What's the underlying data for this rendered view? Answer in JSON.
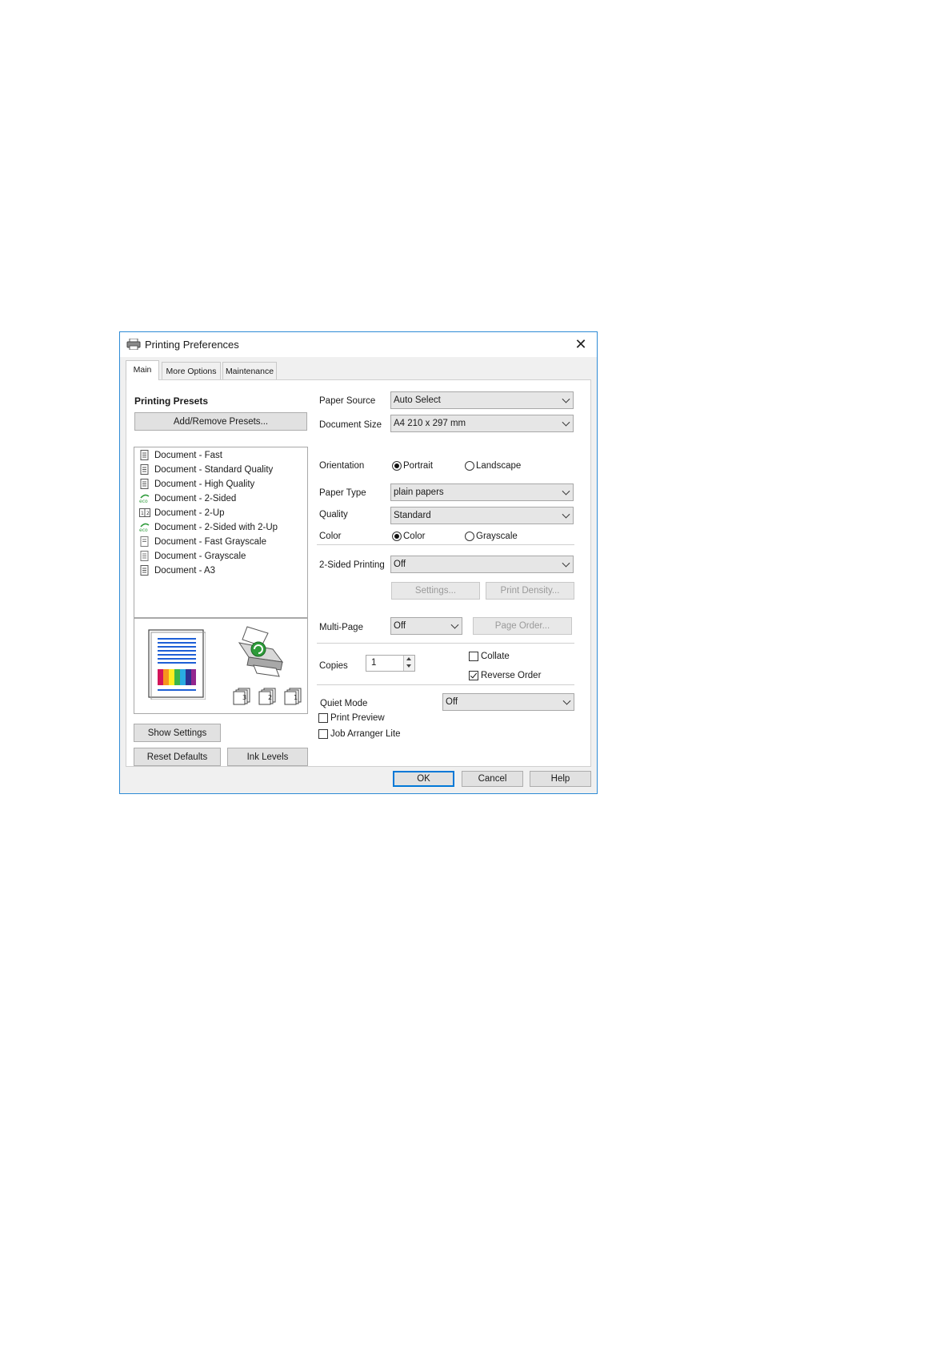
{
  "window": {
    "title": "Printing Preferences"
  },
  "tabs": [
    {
      "label": "Main"
    },
    {
      "label": "More Options"
    },
    {
      "label": "Maintenance"
    }
  ],
  "presets": {
    "heading": "Printing Presets",
    "add_remove_label": "Add/Remove Presets...",
    "items": [
      {
        "label": "Document - Fast",
        "icon": "document-icon"
      },
      {
        "label": "Document - Standard Quality",
        "icon": "document-icon"
      },
      {
        "label": "Document - High Quality",
        "icon": "document-icon"
      },
      {
        "label": "Document - 2-Sided",
        "icon": "eco-icon"
      },
      {
        "label": "Document - 2-Up",
        "icon": "two-up-icon"
      },
      {
        "label": "Document - 2-Sided with 2-Up",
        "icon": "eco-icon"
      },
      {
        "label": "Document - Fast Grayscale",
        "icon": "document-icon"
      },
      {
        "label": "Document - Grayscale",
        "icon": "document-icon"
      },
      {
        "label": "Document - A3",
        "icon": "document-icon"
      }
    ],
    "preview_copy_numbers": [
      "3",
      "2",
      "1"
    ]
  },
  "buttons": {
    "show_settings": "Show Settings",
    "reset_defaults": "Reset Defaults",
    "ink_levels": "Ink Levels",
    "settings": "Settings...",
    "print_density": "Print Density...",
    "page_order": "Page Order...",
    "ok": "OK",
    "cancel": "Cancel",
    "help": "Help"
  },
  "settings": {
    "paper_source": {
      "label": "Paper Source",
      "value": "Auto Select"
    },
    "document_size": {
      "label": "Document Size",
      "value": "A4 210 x 297 mm"
    },
    "orientation": {
      "label": "Orientation",
      "options": [
        "Portrait",
        "Landscape"
      ],
      "selected": "Portrait"
    },
    "paper_type": {
      "label": "Paper Type",
      "value": "plain papers"
    },
    "quality": {
      "label": "Quality",
      "value": "Standard"
    },
    "color": {
      "label": "Color",
      "options": [
        "Color",
        "Grayscale"
      ],
      "selected": "Color"
    },
    "two_sided": {
      "label": "2-Sided Printing",
      "value": "Off"
    },
    "multi_page": {
      "label": "Multi-Page",
      "value": "Off"
    },
    "copies": {
      "label": "Copies",
      "value": "1"
    },
    "collate": {
      "label": "Collate",
      "checked": false
    },
    "reverse_order": {
      "label": "Reverse Order",
      "checked": true
    },
    "quiet_mode": {
      "label": "Quiet Mode",
      "value": "Off"
    },
    "print_preview": {
      "label": "Print Preview",
      "checked": false
    },
    "job_arranger": {
      "label": "Job Arranger Lite",
      "checked": false
    }
  },
  "colors": {
    "accent": "#0078d7",
    "window_border": "#2e8bd6",
    "eco_green": "#2e9b3a"
  }
}
